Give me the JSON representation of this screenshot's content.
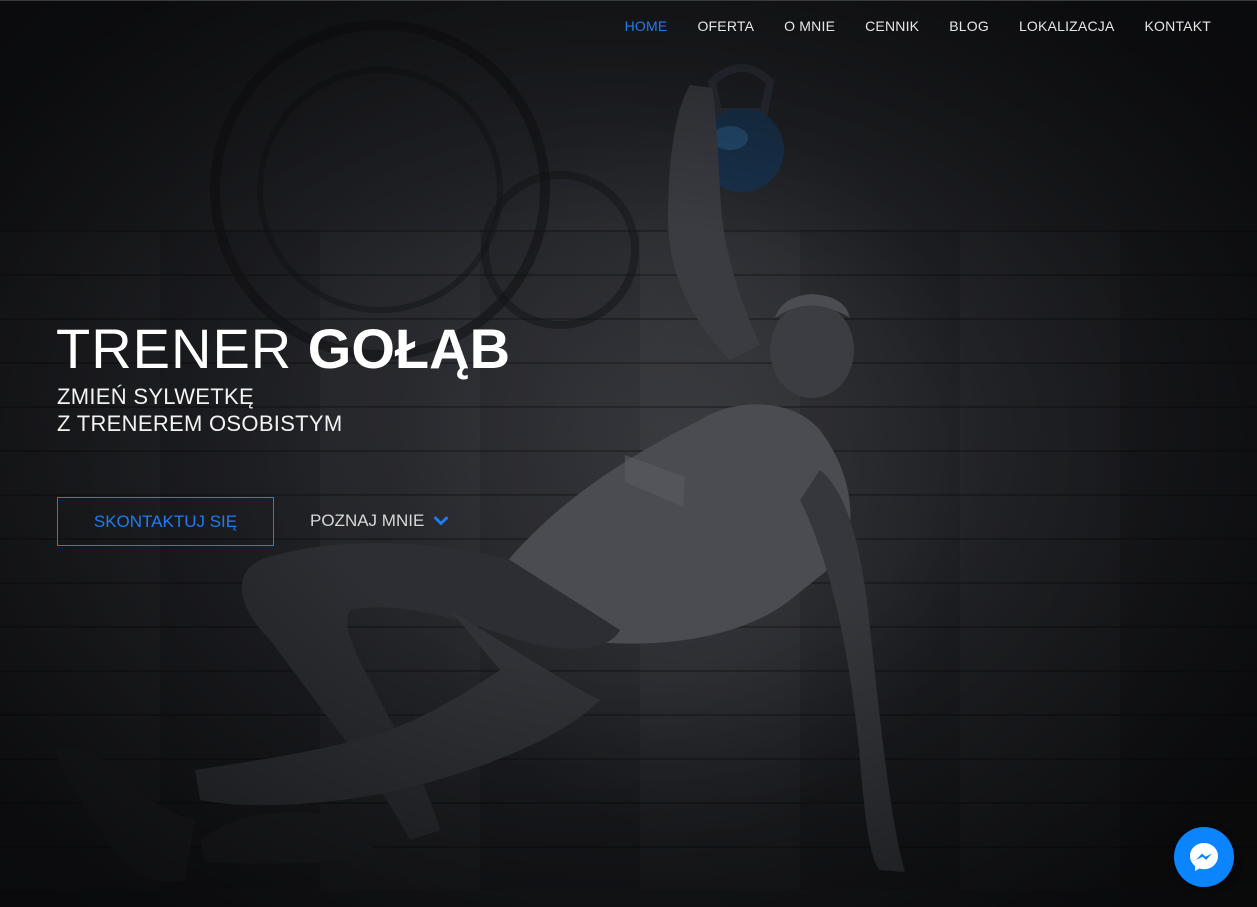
{
  "nav": {
    "items": [
      {
        "label": "HOME",
        "active": true
      },
      {
        "label": "OFERTA"
      },
      {
        "label": "O MNIE"
      },
      {
        "label": "CENNIK"
      },
      {
        "label": "BLOG"
      },
      {
        "label": "LOKALIZACJA"
      },
      {
        "label": "KONTAKT"
      }
    ]
  },
  "hero": {
    "title_light": "TRENER",
    "title_bold": "GOŁĄB",
    "subtitle_line1": "ZMIEŃ SYLWETKĘ",
    "subtitle_line2": "Z TRENEREM OSOBISTYM",
    "cta_label": "SKONTAKTUJ SIĘ",
    "more_label": "POZNAJ MNIE"
  },
  "colors": {
    "accent": "#1e7cf0",
    "background": "#1b1c20",
    "messenger": "#0a84ff"
  },
  "icons": {
    "more": "chevron-down-icon",
    "chat": "messenger-icon"
  }
}
